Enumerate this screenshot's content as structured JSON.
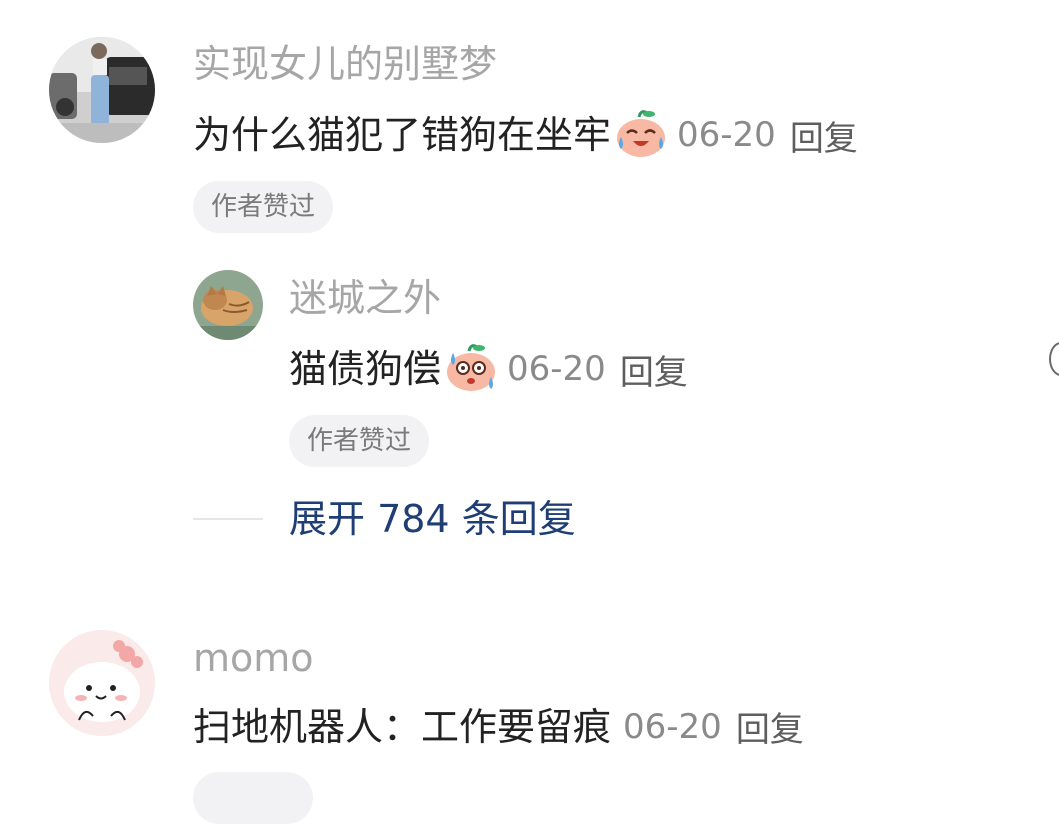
{
  "comments": [
    {
      "username": "实现女儿的别墅梦",
      "text": "为什么猫犯了错狗在坐牢",
      "emoji": "crying-laughing-emoji",
      "date": "06-20",
      "reply_label": "回复",
      "badge": "作者赞过",
      "replies": [
        {
          "username": "迷城之外",
          "text": "猫债狗偿",
          "emoji": "sweating-shocked-emoji",
          "date": "06-20",
          "reply_label": "回复",
          "badge": "作者赞过"
        }
      ],
      "expand_label": "展开 784 条回复"
    },
    {
      "username": "momo",
      "text": "扫地机器人：工作要留痕",
      "date": "06-20",
      "reply_label": "回复"
    }
  ],
  "colors": {
    "username": "#a6a6a6",
    "text": "#222222",
    "meta": "#8a8a8a",
    "badge_bg": "#f2f2f4",
    "expand_link": "#1f3e75"
  }
}
